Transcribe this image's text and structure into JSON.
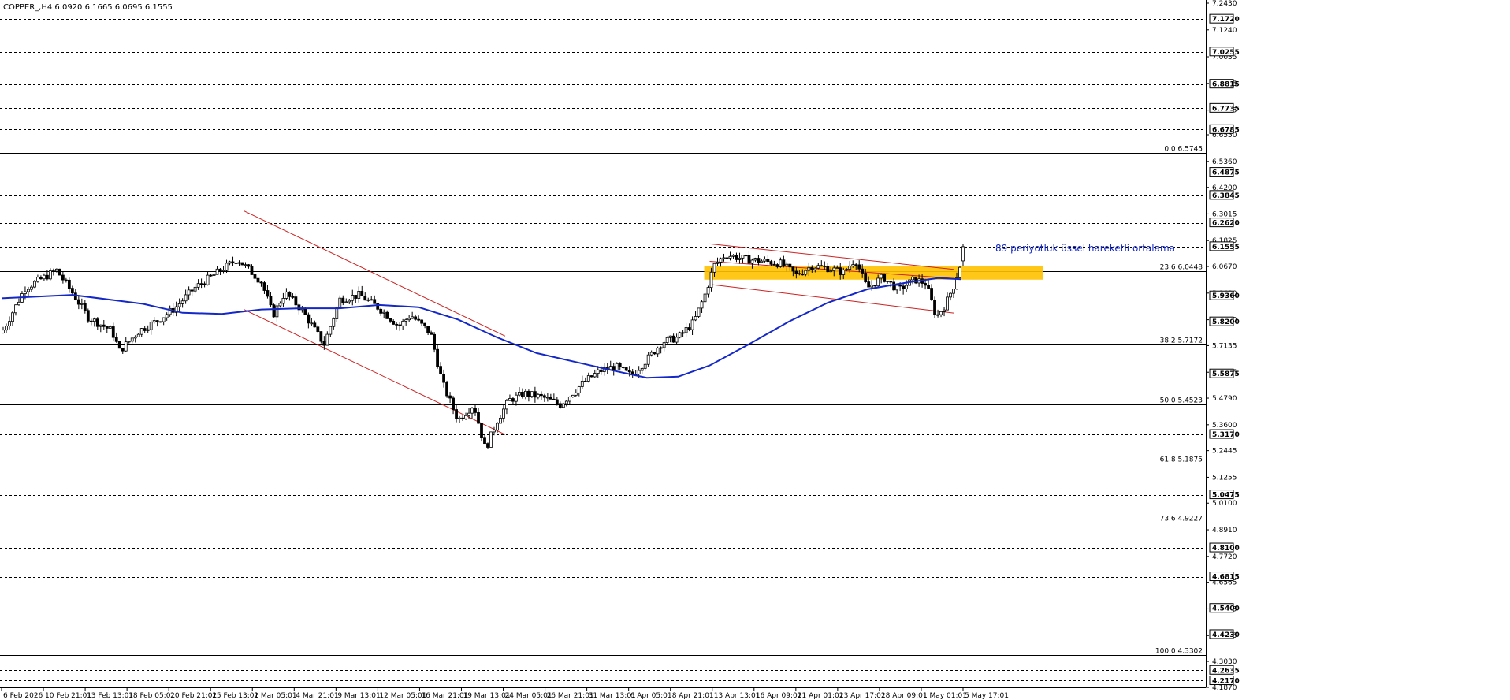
{
  "header": {
    "symbol": "COPPER_,H4",
    "ohlc": "6.0920 6.1665 6.0695 6.1555"
  },
  "colors": {
    "background": "#ffffff",
    "candle": "#000000",
    "ema": "#1428c8",
    "channel": "#cc2222",
    "zone": "#ffc200",
    "fib": "#000000",
    "annotation": "#1428c8"
  },
  "chart_data": {
    "type": "candlestick",
    "symbol": "COPPER_",
    "timeframe": "H4",
    "ylim": [
      4.187,
      7.243
    ],
    "y_ticks": [
      7.243,
      7.124,
      7.0035,
      6.8845,
      6.7655,
      6.655,
      6.536,
      6.42,
      6.3015,
      6.1825,
      6.067,
      5.948,
      5.829,
      5.7135,
      5.5945,
      5.479,
      5.36,
      5.2445,
      5.1255,
      5.01,
      4.891,
      4.772,
      4.6565,
      4.5375,
      4.4185,
      4.303,
      4.187
    ],
    "y_tick_labels": [
      "7.2430",
      "7.1240",
      "7.0035",
      "6.8845",
      "6.7655",
      "6.6550",
      "6.5360",
      "6.4200",
      "6.3015",
      "6.1825",
      "6.0670",
      "5.9480",
      "5.8290",
      "5.7135",
      "5.5945",
      "5.4790",
      "5.3600",
      "5.2445",
      "5.1255",
      "5.0100",
      "4.8910",
      "4.7720",
      "4.6565",
      "4.5375",
      "4.4185",
      "4.3030",
      "4.1870"
    ],
    "x_labels": [
      "6 Feb 2026",
      "10 Feb 21:01",
      "13 Feb 13:01",
      "18 Feb 05:01",
      "20 Feb 21:01",
      "25 Feb 13:01",
      "2 Mar 05:01",
      "4 Mar 21:01",
      "9 Mar 13:01",
      "12 Mar 05:01",
      "16 Mar 21:01",
      "19 Mar 13:01",
      "24 Mar 05:01",
      "26 Mar 21:01",
      "31 Mar 13:01",
      "6 Apr 05:01",
      "8 Apr 21:01",
      "13 Apr 13:01",
      "16 Apr 09:01",
      "21 Apr 01:01",
      "23 Apr 17:01",
      "28 Apr 09:01",
      "1 May 01:01",
      "5 May 17:01"
    ],
    "horizontal_levels": [
      {
        "value": 7.172,
        "label": "7.1720"
      },
      {
        "value": 7.0255,
        "label": "7.0255"
      },
      {
        "value": 6.8815,
        "label": "6.8815"
      },
      {
        "value": 6.7735,
        "label": "6.7735"
      },
      {
        "value": 6.6785,
        "label": "6.6785"
      },
      {
        "value": 6.4875,
        "label": "6.4875"
      },
      {
        "value": 6.3845,
        "label": "6.3845"
      },
      {
        "value": 6.262,
        "label": "6.2620"
      },
      {
        "value": 6.1555,
        "label": "6.1555"
      },
      {
        "value": 5.936,
        "label": "5.9360"
      },
      {
        "value": 5.82,
        "label": "5.8200"
      },
      {
        "value": 5.5875,
        "label": "5.5875"
      },
      {
        "value": 5.317,
        "label": "5.3170"
      },
      {
        "value": 5.0475,
        "label": "5.0475"
      },
      {
        "value": 4.81,
        "label": "4.8100"
      },
      {
        "value": 4.6815,
        "label": "4.6815"
      },
      {
        "value": 4.54,
        "label": "4.5400"
      },
      {
        "value": 4.423,
        "label": "4.4230"
      },
      {
        "value": 4.2635,
        "label": "4.2635"
      },
      {
        "value": 4.217,
        "label": "4.2170"
      }
    ],
    "fibonacci": [
      {
        "level": "0.0",
        "value": 6.5745,
        "label": "0.0 6.5745"
      },
      {
        "level": "23.6",
        "value": 6.0448,
        "label": "23.6 6.0448"
      },
      {
        "level": "38.2",
        "value": 5.7172,
        "label": "38.2 5.7172"
      },
      {
        "level": "50.0",
        "value": 5.4523,
        "label": "50.0 5.4523"
      },
      {
        "level": "61.8",
        "value": 5.1875,
        "label": "61.8 5.1875"
      },
      {
        "level": "73.6",
        "value": 4.9227,
        "label": "73.6 4.9227"
      },
      {
        "level": "100.0",
        "value": 4.3302,
        "label": "100.0 4.3302"
      }
    ],
    "ema_period": 89,
    "ema_path": [
      [
        0,
        5.925
      ],
      [
        90,
        5.94
      ],
      [
        180,
        5.9
      ],
      [
        230,
        5.86
      ],
      [
        280,
        5.855
      ],
      [
        330,
        5.875
      ],
      [
        380,
        5.88
      ],
      [
        430,
        5.88
      ],
      [
        480,
        5.895
      ],
      [
        530,
        5.885
      ],
      [
        580,
        5.83
      ],
      [
        630,
        5.75
      ],
      [
        680,
        5.68
      ],
      [
        730,
        5.64
      ],
      [
        780,
        5.6
      ],
      [
        820,
        5.57
      ],
      [
        860,
        5.575
      ],
      [
        900,
        5.625
      ],
      [
        950,
        5.72
      ],
      [
        1000,
        5.82
      ],
      [
        1050,
        5.905
      ],
      [
        1100,
        5.965
      ],
      [
        1150,
        5.995
      ],
      [
        1190,
        6.015
      ],
      [
        1220,
        6.01
      ]
    ],
    "price_path": [
      [
        0,
        5.77
      ],
      [
        30,
        5.97
      ],
      [
        70,
        6.05
      ],
      [
        90,
        5.95
      ],
      [
        110,
        5.84
      ],
      [
        140,
        5.78
      ],
      [
        150,
        5.69
      ],
      [
        175,
        5.78
      ],
      [
        200,
        5.83
      ],
      [
        220,
        5.88
      ],
      [
        245,
        5.97
      ],
      [
        270,
        6.03
      ],
      [
        300,
        6.1
      ],
      [
        330,
        6.0
      ],
      [
        345,
        5.85
      ],
      [
        360,
        5.95
      ],
      [
        380,
        5.88
      ],
      [
        410,
        5.72
      ],
      [
        430,
        5.92
      ],
      [
        455,
        5.94
      ],
      [
        480,
        5.88
      ],
      [
        505,
        5.8
      ],
      [
        520,
        5.85
      ],
      [
        545,
        5.77
      ],
      [
        560,
        5.55
      ],
      [
        580,
        5.38
      ],
      [
        600,
        5.45
      ],
      [
        615,
        5.25
      ],
      [
        630,
        5.38
      ],
      [
        645,
        5.47
      ],
      [
        665,
        5.5
      ],
      [
        690,
        5.48
      ],
      [
        710,
        5.45
      ],
      [
        740,
        5.55
      ],
      [
        760,
        5.6
      ],
      [
        780,
        5.62
      ],
      [
        800,
        5.58
      ],
      [
        820,
        5.65
      ],
      [
        840,
        5.73
      ],
      [
        860,
        5.75
      ],
      [
        880,
        5.82
      ],
      [
        895,
        5.95
      ],
      [
        905,
        6.07
      ],
      [
        920,
        6.12
      ],
      [
        945,
        6.1
      ],
      [
        970,
        6.09
      ],
      [
        990,
        6.08
      ],
      [
        1010,
        6.03
      ],
      [
        1030,
        6.07
      ],
      [
        1050,
        6.06
      ],
      [
        1070,
        6.04
      ],
      [
        1085,
        6.1
      ],
      [
        1100,
        5.97
      ],
      [
        1120,
        6.02
      ],
      [
        1140,
        5.96
      ],
      [
        1160,
        6.01
      ],
      [
        1175,
        5.99
      ],
      [
        1188,
        5.84
      ],
      [
        1200,
        5.9
      ],
      [
        1210,
        5.98
      ],
      [
        1218,
        6.07
      ],
      [
        1222,
        6.1555
      ]
    ],
    "channels": [
      {
        "from": [
          308,
          6.315
        ],
        "to": [
          640,
          5.756
        ]
      },
      {
        "from": [
          308,
          5.875
        ],
        "to": [
          640,
          5.316
        ]
      },
      {
        "from": [
          900,
          6.168
        ],
        "to": [
          1210,
          6.054
        ]
      },
      {
        "from": [
          900,
          5.987
        ],
        "to": [
          1210,
          5.859
        ]
      },
      {
        "from": [
          900,
          6.09
        ],
        "to": [
          1210,
          6.014
        ]
      }
    ],
    "zone": {
      "low": 6.008,
      "high": 6.068
    },
    "annotation": "89 periyotluk üssel hareketli ortalama"
  }
}
